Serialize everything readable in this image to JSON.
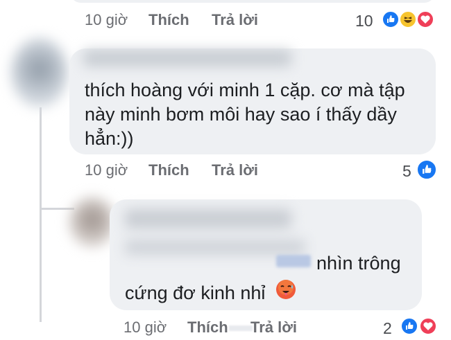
{
  "comment0": {
    "time": "10 giờ",
    "like_label": "Thích",
    "reply_label": "Trả lời",
    "reaction_count": "10"
  },
  "comment1": {
    "text_line1": "thích hoàng với minh 1 cặp. cơ mà tập",
    "text_line2": "này minh bơm môi hay sao í thấy dầy",
    "text_line3": "hẳn:))",
    "time": "10 giờ",
    "like_label": "Thích",
    "reply_label": "Trả lời",
    "reaction_count": "5"
  },
  "comment2": {
    "text_line1": "nhìn trông",
    "text_line2": "cứng đơ kinh nhỉ",
    "time": "10 giờ",
    "like_label": "Thích",
    "reply_label": "Trả lời",
    "reaction_count": "2"
  },
  "colors": {
    "like_blue": "#1877f2",
    "haha_yellow": "#f7c42e",
    "love_red": "#ef3f58",
    "bubble_bg": "#eef0f3"
  }
}
